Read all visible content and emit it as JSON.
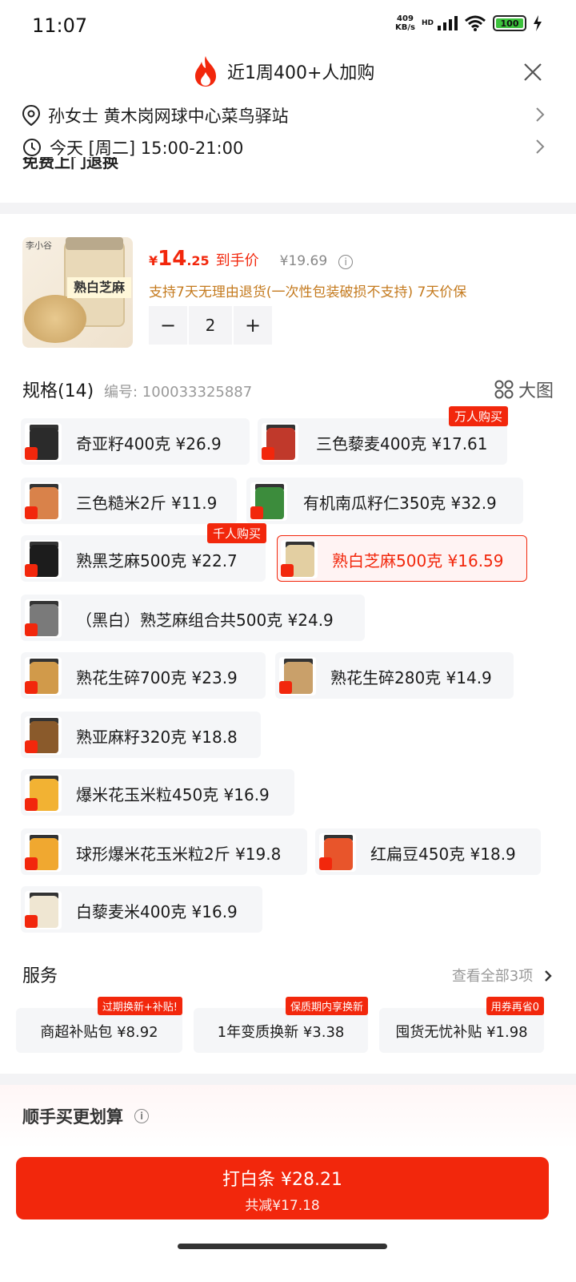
{
  "status": {
    "time": "11:07",
    "net_speed": "409",
    "net_unit": "KB/s",
    "hd": "HD",
    "battery": "100"
  },
  "banner": {
    "text": "近1周400+人加购"
  },
  "address": {
    "text": "孙女士  黄木岗网球中心菜鸟驿站"
  },
  "delivery": {
    "text": "今天 [周二] 15:00-21:00"
  },
  "cut_text": "免费上门退换",
  "product": {
    "image_brand": "李小谷",
    "image_label": "熟白芝麻",
    "currency": "¥",
    "price_int": "14",
    "price_dec": ".25",
    "price_tag": "到手价",
    "orig_price": "¥19.69",
    "info_glyph": "i",
    "return_policy": "支持7天无理由退货(一次性包装破损不支持)  7天价保",
    "quantity": "2",
    "minus": "−",
    "plus": "+"
  },
  "spec": {
    "title": "规格(14)",
    "code": "编号: 100033325887",
    "big_image": "大图"
  },
  "variants": [
    {
      "label": "奇亚籽400克   ¥26.9",
      "badge": "",
      "color": "#2b2b2b"
    },
    {
      "label": "三色藜麦400克   ¥17.61",
      "badge": "万人购买",
      "color": "#c0392b"
    },
    {
      "label": "三色糙米2斤   ¥11.9",
      "badge": "",
      "color": "#d9824a"
    },
    {
      "label": "有机南瓜籽仁350克   ¥32.9",
      "badge": "",
      "color": "#3c8c3c"
    },
    {
      "label": "熟黑芝麻500克   ¥22.7",
      "badge": "千人购买",
      "color": "#1c1c1c"
    },
    {
      "label": "熟白芝麻500克   ¥16.59",
      "badge": "",
      "color": "#e3cfa2",
      "selected": true
    },
    {
      "label": "（黑白）熟芝麻组合共500克   ¥24.9",
      "badge": "",
      "color": "#7a7a7a"
    },
    {
      "label": "熟花生碎700克   ¥23.9",
      "badge": "",
      "color": "#d19a4a"
    },
    {
      "label": "熟花生碎280克   ¥14.9",
      "badge": "",
      "color": "#c9a06a"
    },
    {
      "label": "熟亚麻籽320克   ¥18.8",
      "badge": "",
      "color": "#8a5a2b"
    },
    {
      "label": "爆米花玉米粒450克   ¥16.9",
      "badge": "",
      "color": "#f2b233"
    },
    {
      "label": "球形爆米花玉米粒2斤   ¥19.8",
      "badge": "",
      "color": "#f0a830"
    },
    {
      "label": "红扁豆450克   ¥18.9",
      "badge": "",
      "color": "#e8552b"
    },
    {
      "label": "白藜麦米400克   ¥16.9",
      "badge": "",
      "color": "#efe6d2"
    }
  ],
  "service": {
    "title": "服务",
    "all": "查看全部3项",
    "items": [
      {
        "label": "商超补贴包  ¥8.92",
        "badge": "过期换新+补贴!"
      },
      {
        "label": "1年变质换新  ¥3.38",
        "badge": "保质期内享换新"
      },
      {
        "label": "囤货无忧补贴  ¥1.98",
        "badge": "用券再省0"
      }
    ]
  },
  "more": {
    "title": "顺手买更划算"
  },
  "bottom": {
    "pay_label": "打白条 ¥28.21",
    "saved": "共减¥17.18"
  },
  "colors": {
    "accent": "#f2270c",
    "warning": "#c47a1e"
  }
}
